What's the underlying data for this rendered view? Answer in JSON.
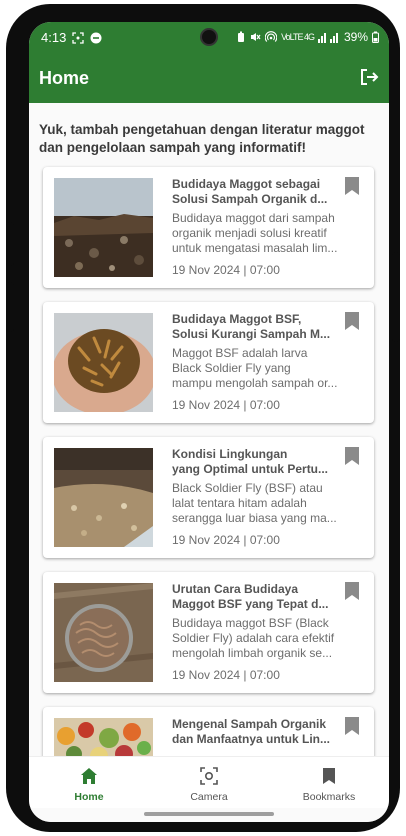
{
  "status": {
    "time": "4:13",
    "signal_text": "VoLTE 4G",
    "battery": "39%"
  },
  "appbar": {
    "title": "Home",
    "logout_icon": "logout-icon"
  },
  "intro": "Yuk, tambah pengetahuan dengan literatur maggot dan pengelolaan sampah yang informatif!",
  "articles": [
    {
      "title": "Budidaya Maggot sebagai\nSolusi Sampah Organik d...",
      "desc": "Budidaya maggot dari sampah\norganik menjadi solusi kreatif\nuntuk mengatasi masalah lim...",
      "date": "19 Nov 2024 | 07:00"
    },
    {
      "title": "Budidaya Maggot BSF,\nSolusi Kurangi Sampah M...",
      "desc": "Maggot BSF adalah larva\nBlack Soldier Fly yang\nmampu mengolah sampah or...",
      "date": "19 Nov 2024 | 07:00"
    },
    {
      "title": "Kondisi Lingkungan\nyang Optimal untuk Pertu...",
      "desc": "Black Soldier Fly (BSF) atau\nlalat tentara hitam adalah\nserangga luar biasa yang ma...",
      "date": "19 Nov 2024 | 07:00"
    },
    {
      "title": "Urutan Cara Budidaya\nMaggot BSF yang Tepat d...",
      "desc": "Budidaya maggot BSF (Black\nSoldier Fly) adalah cara efektif\nmengolah limbah organik se...",
      "date": "19 Nov 2024 | 07:00"
    },
    {
      "title": "Mengenal Sampah Organik\ndan Manfaatnya untuk Lin...",
      "desc": "",
      "date": ""
    }
  ],
  "nav": {
    "home": "Home",
    "camera": "Camera",
    "bookmarks": "Bookmarks"
  },
  "colors": {
    "primary": "#2e7d32",
    "bookmark": "#8a8a8a"
  }
}
